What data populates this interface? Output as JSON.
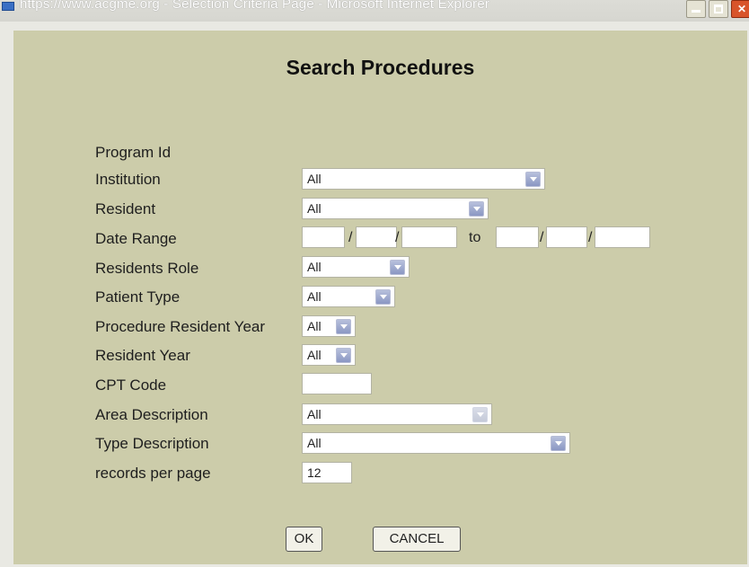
{
  "window": {
    "title": "https://www.acgme.org - Selection Criteria Page - Microsoft Internet Explorer",
    "close_glyph": "✕"
  },
  "form": {
    "heading": "Search Procedures",
    "labels": {
      "program_id": "Program Id",
      "institution": "Institution",
      "resident": "Resident",
      "date_range": "Date Range",
      "residents_role": "Residents Role",
      "patient_type": "Patient Type",
      "procedure_resident_year": "Procedure Resident Year",
      "resident_year": "Resident Year",
      "cpt_code": "CPT Code",
      "area_description": "Area Description",
      "type_description": "Type Description",
      "records_per_page": "records per page"
    },
    "values": {
      "institution": "All",
      "resident": "All",
      "residents_role": "All",
      "patient_type": "All",
      "procedure_resident_year": "All",
      "resident_year": "All",
      "cpt_code": "",
      "area_description": "All",
      "type_description": "All",
      "records_per_page": "12",
      "date_from_month": "",
      "date_from_day": "",
      "date_from_year": "",
      "date_to_month": "",
      "date_to_day": "",
      "date_to_year": ""
    },
    "date_separator": "/",
    "date_to_label": "to"
  },
  "buttons": {
    "ok": "OK",
    "cancel": "CANCEL"
  }
}
